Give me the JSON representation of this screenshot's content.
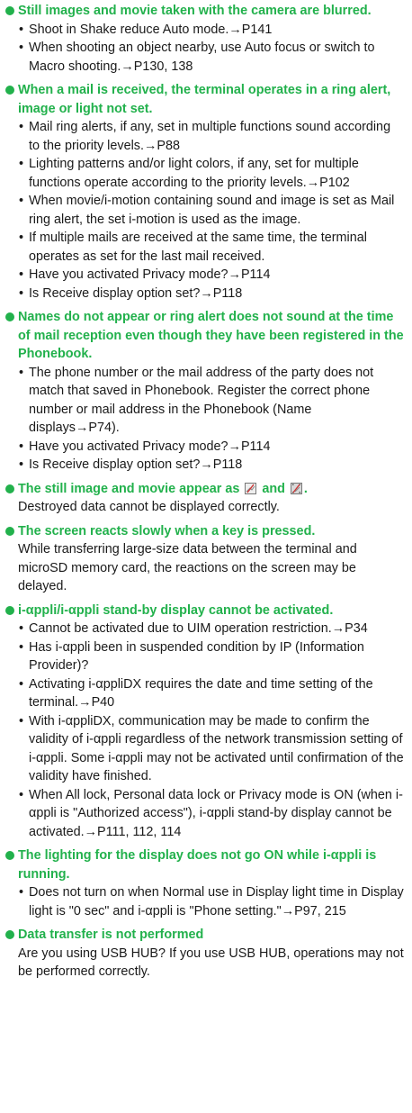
{
  "colors": {
    "heading": "#22b14c",
    "text": "#1a1a1a",
    "background": "#ffffff"
  },
  "items": [
    {
      "heading": "Still images and movie taken with the camera are blurred.",
      "bullets": [
        "Shoot in Shake reduce Auto mode.→P141",
        "When shooting an object nearby, use Auto focus or switch to Macro shooting.→P130, 138"
      ]
    },
    {
      "heading": "When a mail is received, the terminal operates in a ring alert, image or light not set.",
      "bullets": [
        "Mail ring alerts, if any, set in multiple functions sound according to the priority levels.→P88",
        "Lighting patterns and/or light colors, if any, set for multiple functions operate according to the priority levels.→P102",
        "When movie/i-motion containing sound and image is set as Mail ring alert, the set i-motion is used as the image.",
        "If multiple mails are received at the same time, the terminal operates as set for the last mail received.",
        "Have you activated Privacy mode?→P114",
        "Is Receive display option set?→P118"
      ]
    },
    {
      "heading": "Names do not appear or ring alert does not sound at the time of mail reception even though they have been registered in the Phonebook.",
      "bullets": [
        "The phone number or the mail address of the party does not match that saved in Phonebook. Register the correct phone number or mail address in the Phonebook (Name displays→P74).",
        "Have you activated Privacy mode?→P114",
        "Is Receive display option set?→P118"
      ]
    },
    {
      "heading": "The still image and movie appear as",
      "heading_icons": [
        "broken-image-icon",
        "broken-movie-icon"
      ],
      "heading_join": "and",
      "heading_end": ".",
      "text": "Destroyed data cannot be displayed correctly."
    },
    {
      "heading": "The screen reacts slowly when a key is pressed.",
      "text": "While transferring large-size data between the terminal and microSD memory card, the reactions on the screen may be delayed."
    },
    {
      "heading": "i-αppli/i-αppli stand-by display cannot be activated.",
      "bullets": [
        "Cannot be activated due to UIM operation restriction.→P34",
        "Has i-αppli been in suspended condition by IP (Information Provider)?",
        "Activating i-αppliDX requires the date and time setting of the terminal.→P40",
        "With i-αppliDX, communication may be made to confirm the validity of i-αppli regardless of the network transmission setting of i-αppli. Some i-αppli may not be activated until confirmation of the validity have finished.",
        "When All lock, Personal data lock or Privacy mode is ON (when i-αppli is \"Authorized access\"), i-αppli stand-by display cannot be activated.→P111, 112, 114"
      ]
    },
    {
      "heading": "The lighting for the display does not go ON while i-αppli is running.",
      "bullets": [
        "Does not turn on when Normal use in Display light time in Display light is \"0 sec\" and i-αppli is \"Phone setting.\"→P97, 215"
      ]
    },
    {
      "heading": "Data transfer is not performed",
      "text": "Are you using USB HUB? If you use USB HUB, operations may not be performed correctly."
    }
  ]
}
